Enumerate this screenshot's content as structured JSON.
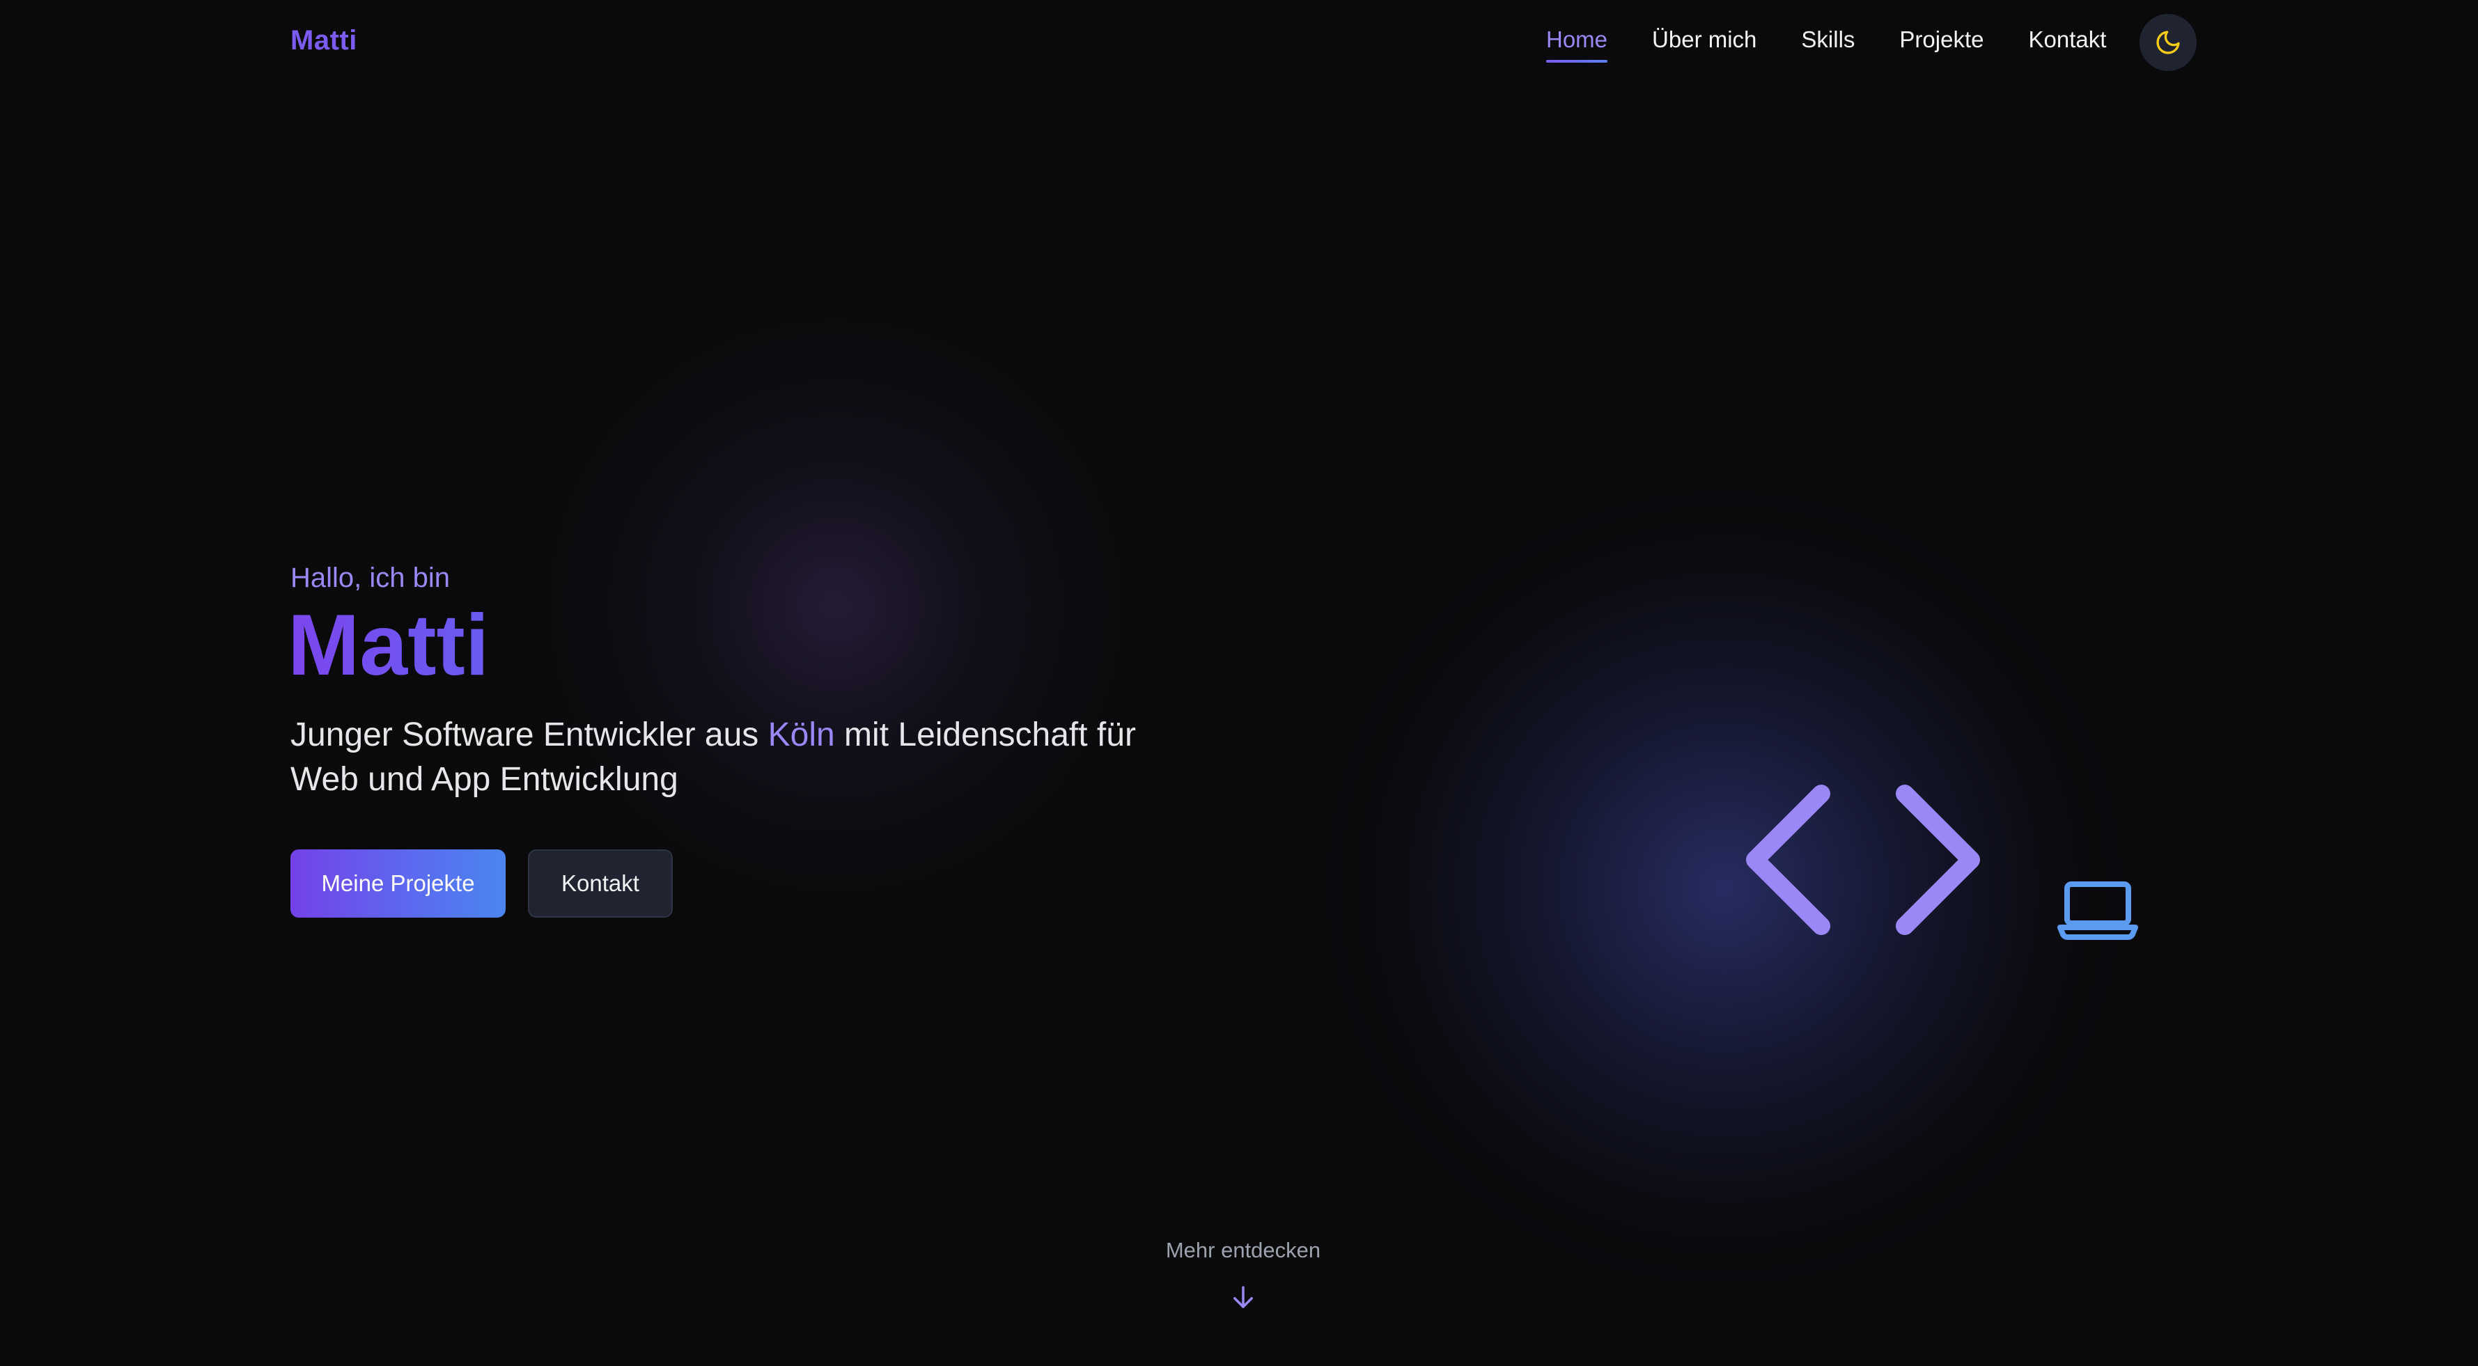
{
  "nav": {
    "logo": "Matti",
    "links": [
      {
        "label": "Home",
        "active": true
      },
      {
        "label": "Über mich",
        "active": false
      },
      {
        "label": "Skills",
        "active": false
      },
      {
        "label": "Projekte",
        "active": false
      },
      {
        "label": "Kontakt",
        "active": false
      }
    ],
    "theme_icon": "moon-icon"
  },
  "hero": {
    "greeting": "Hallo, ich bin",
    "name": "Matti",
    "tagline_before": "Junger Software Entwickler aus ",
    "tagline_highlight": "Köln",
    "tagline_after": " mit Leidenschaft für Web und App Entwicklung",
    "primary_button": "Meine Projekte",
    "secondary_button": "Kontakt",
    "decor_icons": [
      "code-brackets-icon",
      "laptop-icon"
    ]
  },
  "scroll_hint": {
    "label": "Mehr entdecken",
    "icon": "arrow-down-icon"
  },
  "colors": {
    "accent": "#7c5cf0",
    "accent_light": "#9b87f5",
    "blue": "#4b86ef",
    "background": "#0a0a0b",
    "moon": "#facc15"
  }
}
